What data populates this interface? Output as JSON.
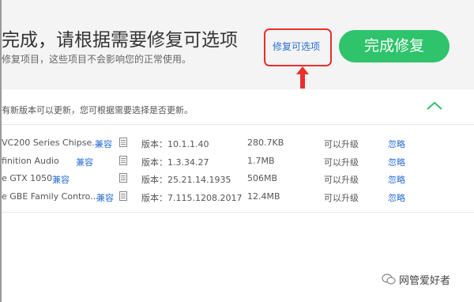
{
  "header": {
    "title": "完成，请根据需要修复可选项",
    "subtitle": "修复项目，这些项目不会影响您的正常使用。",
    "optional_link": "修复可选项",
    "complete_button": "完成修复"
  },
  "section": {
    "note": "有新版本可以更新，您可根据需要选择是否更新。"
  },
  "drivers": [
    {
      "name": "VC200 Series Chipse...",
      "compat": "兼容",
      "version": "版本：10.1.1.40",
      "size": "280.7KB",
      "upgrade": "可以升级",
      "ignore": "忽略"
    },
    {
      "name": "finition Audio",
      "compat": "兼容",
      "version": "版本：1.3.34.27",
      "size": "1.7MB",
      "upgrade": "可以升级",
      "ignore": "忽略"
    },
    {
      "name": "e GTX 1050",
      "compat": "兼容",
      "version": "版本：25.21.14.1935",
      "size": "506MB",
      "upgrade": "可以升级",
      "ignore": "忽略"
    },
    {
      "name": "e GBE Family Contro...",
      "compat": "兼容",
      "version": "版本：7.115.1208.2017",
      "size": "12.4MB",
      "upgrade": "可以升级",
      "ignore": "忽略"
    }
  ],
  "watermark": "网管爱好者",
  "colors": {
    "accent_green": "#2fc36b",
    "link_blue": "#2a6fd6",
    "highlight_red": "#e8302f",
    "header_bg": "#f3f4f3"
  }
}
